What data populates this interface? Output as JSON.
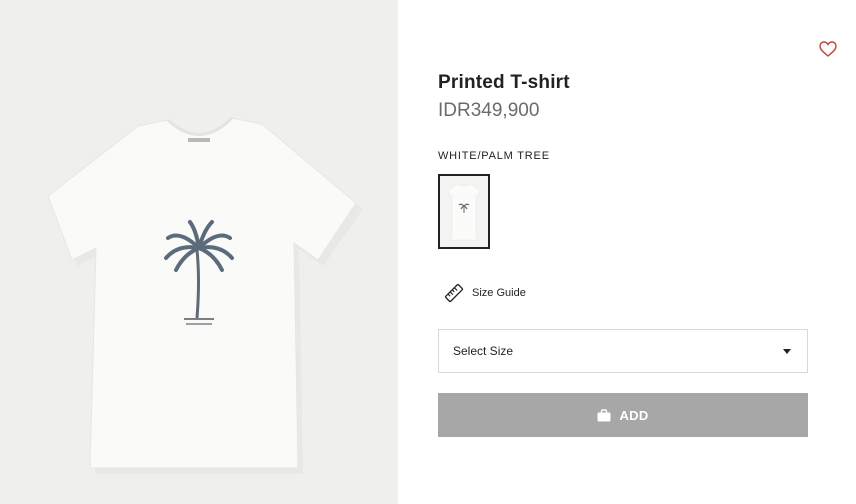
{
  "product": {
    "title": "Printed T-shirt",
    "price": "IDR349,900",
    "color_label": "WHITE/PALM TREE"
  },
  "size_guide": {
    "label": "Size Guide",
    "icon": "ruler-icon"
  },
  "size_select": {
    "selected": "Select Size"
  },
  "add_button": {
    "label": "ADD",
    "icon": "shopping-bag-icon"
  },
  "favorite": {
    "icon": "heart-icon"
  },
  "colors": {
    "image_background": "#efefed",
    "button_disabled": "#a7a7a7",
    "swatch_border": "#222222",
    "heart": "#c0443e"
  }
}
